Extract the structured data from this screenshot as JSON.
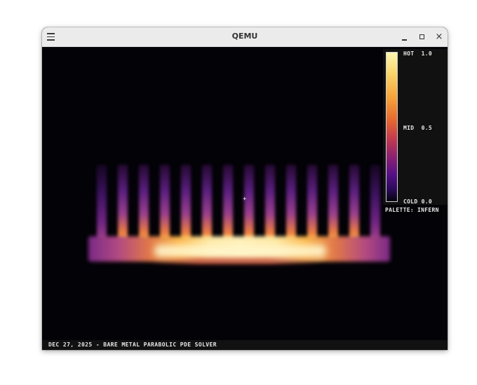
{
  "window": {
    "title": "QEMU"
  },
  "titlebar": {
    "menu_icon": "hamburger-menu-icon",
    "minimize_icon": "minimize-icon",
    "maximize_icon": "maximize-icon",
    "close_icon": "close-icon",
    "close_glyph": "×"
  },
  "legend": {
    "hot": "HOT  1.0",
    "mid": "MID  0.5",
    "cold": "COLD 0.0",
    "palette": "PALETTE: INFERN"
  },
  "status": {
    "text": "DEC 27, 2025 - BARE METAL PARABOLIC PDE SOLVER"
  },
  "simulation": {
    "cursor_glyph": "+",
    "colors": {
      "hot": "#fcf5b0",
      "mid": "#c23b4f",
      "cold": "#05030c"
    }
  }
}
